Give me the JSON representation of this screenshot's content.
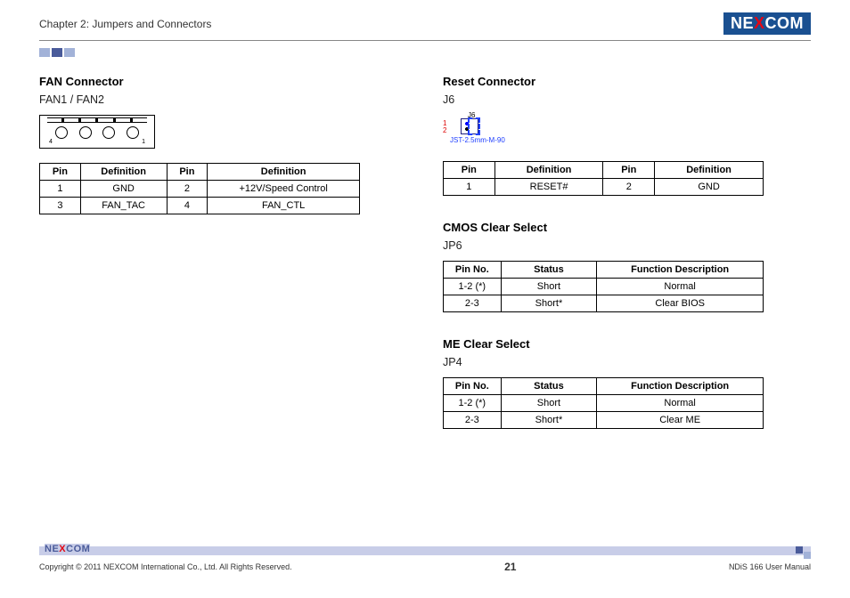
{
  "header": {
    "chapter": "Chapter 2: Jumpers and Connectors",
    "brand_n": "N",
    "brand_e1": "E",
    "brand_x": "X",
    "brand_c": "C",
    "brand_o": "O",
    "brand_m": "M"
  },
  "left": {
    "fan": {
      "title": "FAN Connector",
      "subtitle": "FAN1 / FAN2",
      "diag_label_left": "4",
      "diag_label_right": "1",
      "th_pin": "Pin",
      "th_def": "Definition",
      "rows": [
        {
          "p1": "1",
          "d1": "GND",
          "p2": "2",
          "d2": "+12V/Speed Control"
        },
        {
          "p1": "3",
          "d1": "FAN_TAC",
          "p2": "4",
          "d2": "FAN_CTL"
        }
      ]
    }
  },
  "right": {
    "reset": {
      "title": "Reset Connector",
      "subtitle": "J6",
      "diag_top": "J6",
      "diag_pin1": "1",
      "diag_pin2": "2",
      "diag_part": "JST-2.5mm-M-90",
      "th_pin": "Pin",
      "th_def": "Definition",
      "rows": [
        {
          "p1": "1",
          "d1": "RESET#",
          "p2": "2",
          "d2": "GND"
        }
      ]
    },
    "cmos": {
      "title": "CMOS Clear Select",
      "subtitle": "JP6",
      "th_pin": "Pin No.",
      "th_status": "Status",
      "th_func": "Function Description",
      "rows": [
        {
          "pin": "1-2 (*)",
          "status": "Short",
          "func": "Normal"
        },
        {
          "pin": "2-3",
          "status": "Short*",
          "func": "Clear BIOS"
        }
      ]
    },
    "me": {
      "title": "ME Clear Select",
      "subtitle": "JP4",
      "th_pin": "Pin No.",
      "th_status": "Status",
      "th_func": "Function Description",
      "rows": [
        {
          "pin": "1-2 (*)",
          "status": "Short",
          "func": "Normal"
        },
        {
          "pin": "2-3",
          "status": "Short*",
          "func": "Clear ME"
        }
      ]
    }
  },
  "footer": {
    "copyright": "Copyright © 2011 NEXCOM International Co., Ltd. All Rights Reserved.",
    "page": "21",
    "manual": "NDiS 166 User Manual"
  }
}
